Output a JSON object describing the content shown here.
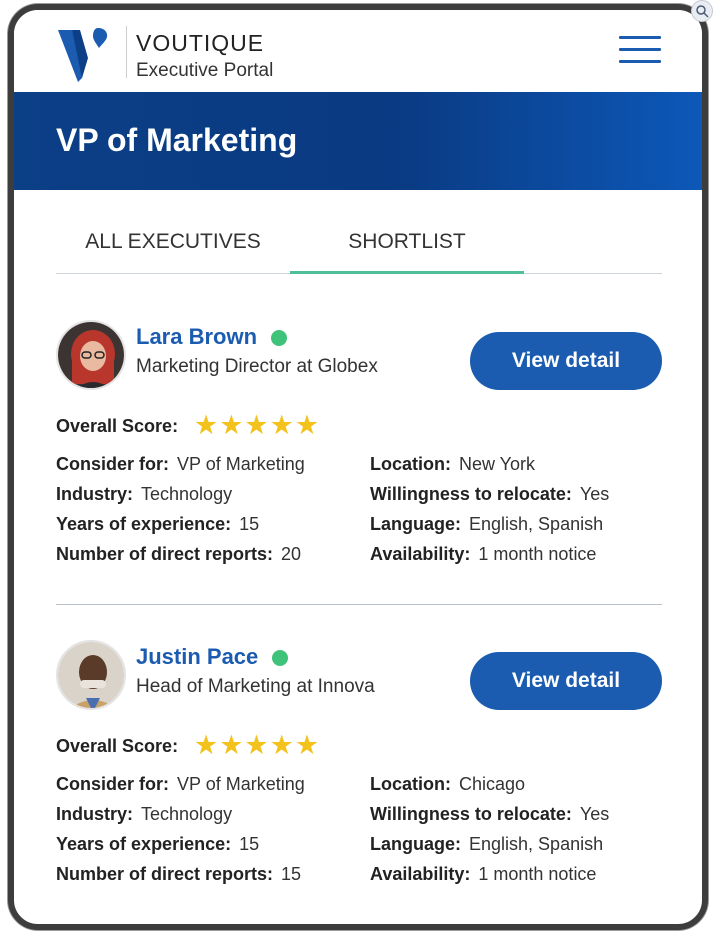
{
  "header": {
    "brand_name": "VOUTIQUE",
    "brand_sub": "Executive Portal",
    "menu_icon": "hamburger-menu-icon"
  },
  "banner": {
    "title": "VP of Marketing"
  },
  "tabs": [
    {
      "label": "ALL EXECUTIVES",
      "active": false
    },
    {
      "label": "SHORTLIST",
      "active": true
    }
  ],
  "labels": {
    "overall_score": "Overall Score:",
    "consider_for": "Consider for:",
    "industry": "Industry:",
    "years": "Years of experience:",
    "reports": "Number of direct reports:",
    "location": "Location:",
    "relocate": "Willingness to relocate:",
    "language": "Language:",
    "availability": "Availability:"
  },
  "candidates": [
    {
      "name": "Lara Brown",
      "title": "Marketing Director at Globex",
      "button_label": "View detail",
      "rating": 5,
      "consider_for": "VP of Marketing",
      "industry": "Technology",
      "years": "15",
      "reports": "20",
      "location": "New York",
      "relocate": "Yes",
      "language": "English, Spanish",
      "availability": "1 month notice"
    },
    {
      "name": "Justin Pace",
      "title": "Head of Marketing at Innova",
      "button_label": "View detail",
      "rating": 5,
      "consider_for": "VP of Marketing",
      "industry": "Technology",
      "years": "15",
      "reports": "15",
      "location": "Chicago",
      "relocate": "Yes",
      "language": "English, Spanish",
      "availability": "1 month notice"
    }
  ],
  "colors": {
    "brand_blue": "#1b5cb0",
    "banner_dark": "#0b3f86",
    "tab_accent": "#4fbf9a",
    "status_online": "#3fc27a",
    "star": "#f3c21c"
  }
}
